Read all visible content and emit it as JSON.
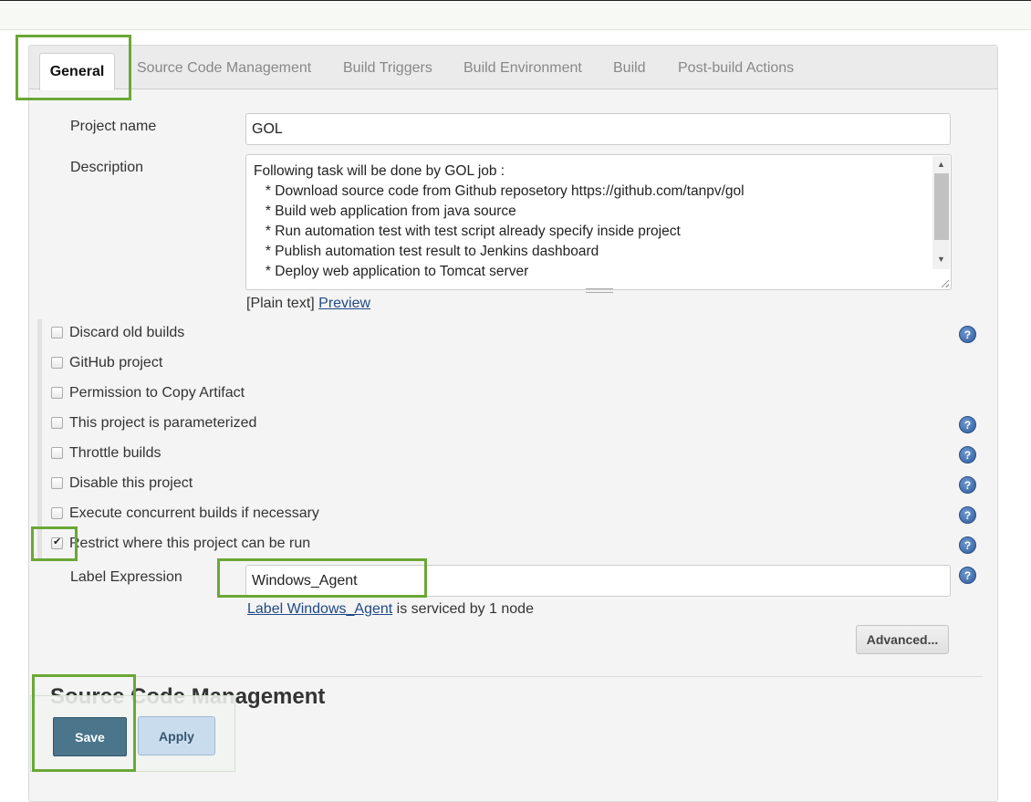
{
  "tabs": [
    {
      "label": "General"
    },
    {
      "label": "Source Code Management"
    },
    {
      "label": "Build Triggers"
    },
    {
      "label": "Build Environment"
    },
    {
      "label": "Build"
    },
    {
      "label": "Post-build Actions"
    }
  ],
  "project_name": {
    "label": "Project name",
    "value": "GOL"
  },
  "description": {
    "label": "Description",
    "lines": [
      "Following task will be done by GOL job :",
      "   * Download source code from Github reposetory https://github.com/tanpv/gol",
      "   * Build web application from java source",
      "   * Run automation test with test script already specify inside project",
      "   * Publish automation test result to Jenkins dashboard",
      "   * Deploy web application to Tomcat server"
    ],
    "format_text": "[Plain text]",
    "preview_link": "Preview"
  },
  "options": [
    {
      "label": "Discard old builds",
      "checked": false,
      "help": true
    },
    {
      "label": "GitHub project",
      "checked": false,
      "help": false
    },
    {
      "label": "Permission to Copy Artifact",
      "checked": false,
      "help": false
    },
    {
      "label": "This project is parameterized",
      "checked": false,
      "help": true
    },
    {
      "label": "Throttle builds",
      "checked": false,
      "help": true
    },
    {
      "label": "Disable this project",
      "checked": false,
      "help": true
    },
    {
      "label": "Execute concurrent builds if necessary",
      "checked": false,
      "help": true
    },
    {
      "label": "Restrict where this project can be run",
      "checked": true,
      "help": true
    }
  ],
  "label_expression": {
    "label": "Label Expression",
    "value": "Windows_Agent",
    "status_link": "Label Windows_Agent",
    "status_text": " is serviced by 1 node"
  },
  "help_glyph": "?",
  "advanced_button": "Advanced...",
  "section_title": "Source Code Management",
  "buttons": {
    "save": "Save",
    "apply": "Apply"
  },
  "colors": {
    "highlight": "#6aa836",
    "save_button": "#4b758b",
    "link": "#204a87"
  }
}
